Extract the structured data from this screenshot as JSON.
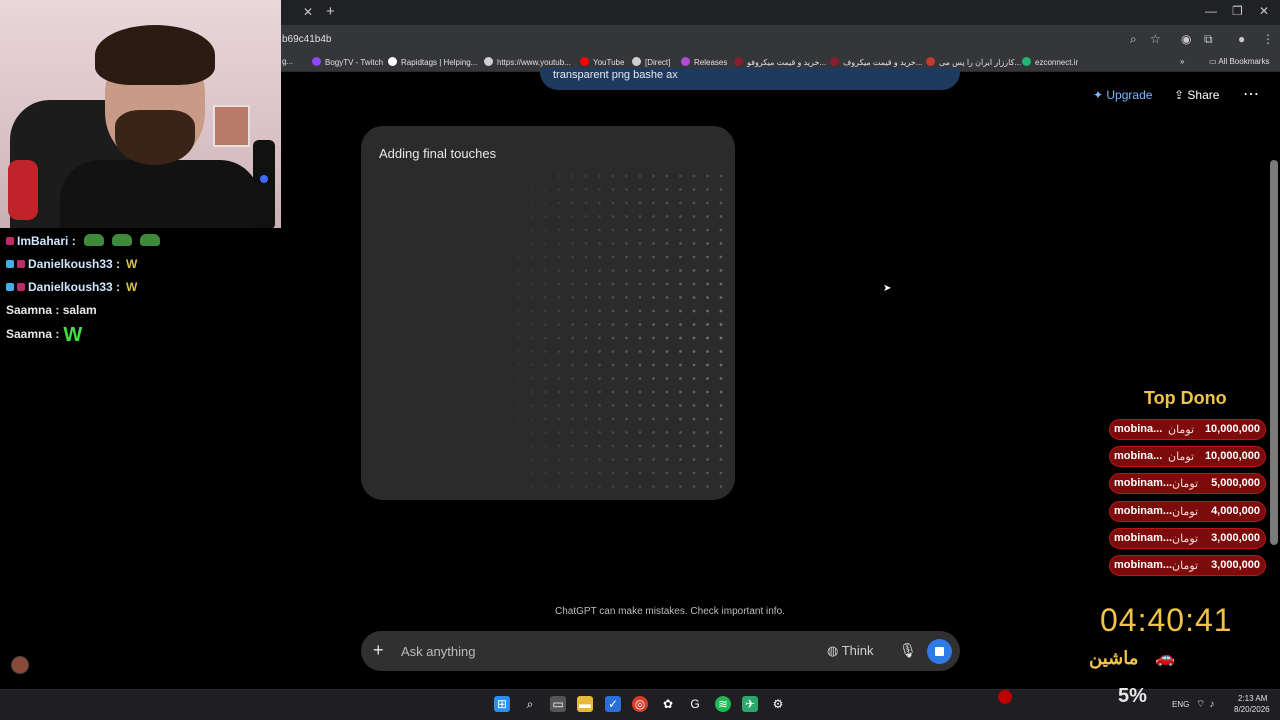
{
  "browser": {
    "url_fragment": "b69c41b4b",
    "bookmarks": [
      {
        "label": "g...",
        "color": "#8a6bd1"
      },
      {
        "label": "BogyTV - Twitch",
        "color": "#9146ff"
      },
      {
        "label": "Rapidtags | Helping...",
        "color": "#ffffff"
      },
      {
        "label": "https://www.youtub...",
        "color": "#cfcfcf"
      },
      {
        "label": "YouTube",
        "color": "#ff0000"
      },
      {
        "label": "[Direct]",
        "color": "#cfcfcf"
      },
      {
        "label": "Releases",
        "color": "#b14bd6"
      },
      {
        "label": "خرید و قیمت میکروفو...",
        "color": "#8a1d2d"
      },
      {
        "label": "خرید و قیمت میکروف...",
        "color": "#8a1d2d"
      },
      {
        "label": "کارزار ایران را پس می...",
        "color": "#c43a2f"
      },
      {
        "label": "ezconnect.ir",
        "color": "#22b573"
      }
    ],
    "all_bookmarks": "All Bookmarks"
  },
  "chat_page": {
    "user_message": "transparent png bashe ax",
    "upgrade": "Upgrade",
    "share": "Share",
    "image_status": "Adding final touches",
    "disclaimer": "ChatGPT can make mistakes. Check important info.",
    "composer_placeholder": "Ask anything",
    "think": "Think"
  },
  "twitch_chat": [
    {
      "user": "ImBahari",
      "emotes": 3,
      "message": ""
    },
    {
      "user": "Danielkoush33",
      "message": "W"
    },
    {
      "user": "Danielkoush33",
      "message": "W"
    },
    {
      "user": "Saamna",
      "message": "salam"
    },
    {
      "user": "Saamna",
      "message": "W"
    }
  ],
  "top_dono": {
    "title": "Top Dono",
    "currency": "تومان",
    "rows": [
      {
        "name": "mobina...",
        "amount": "10,000,000"
      },
      {
        "name": "mobina...",
        "amount": "10,000,000"
      },
      {
        "name": "mobinam...",
        "amount": "5,000,000"
      },
      {
        "name": "mobinam...",
        "amount": "4,000,000"
      },
      {
        "name": "mobinam...",
        "amount": "3,000,000"
      },
      {
        "name": "mobinam...",
        "amount": "3,000,000"
      }
    ]
  },
  "overlay": {
    "timer": "04:40:41",
    "car_label": "ماشین",
    "percent": "5%"
  },
  "taskbar": {
    "lang": "ENG",
    "time": "2:13 AM",
    "date": "8/20/2026"
  }
}
